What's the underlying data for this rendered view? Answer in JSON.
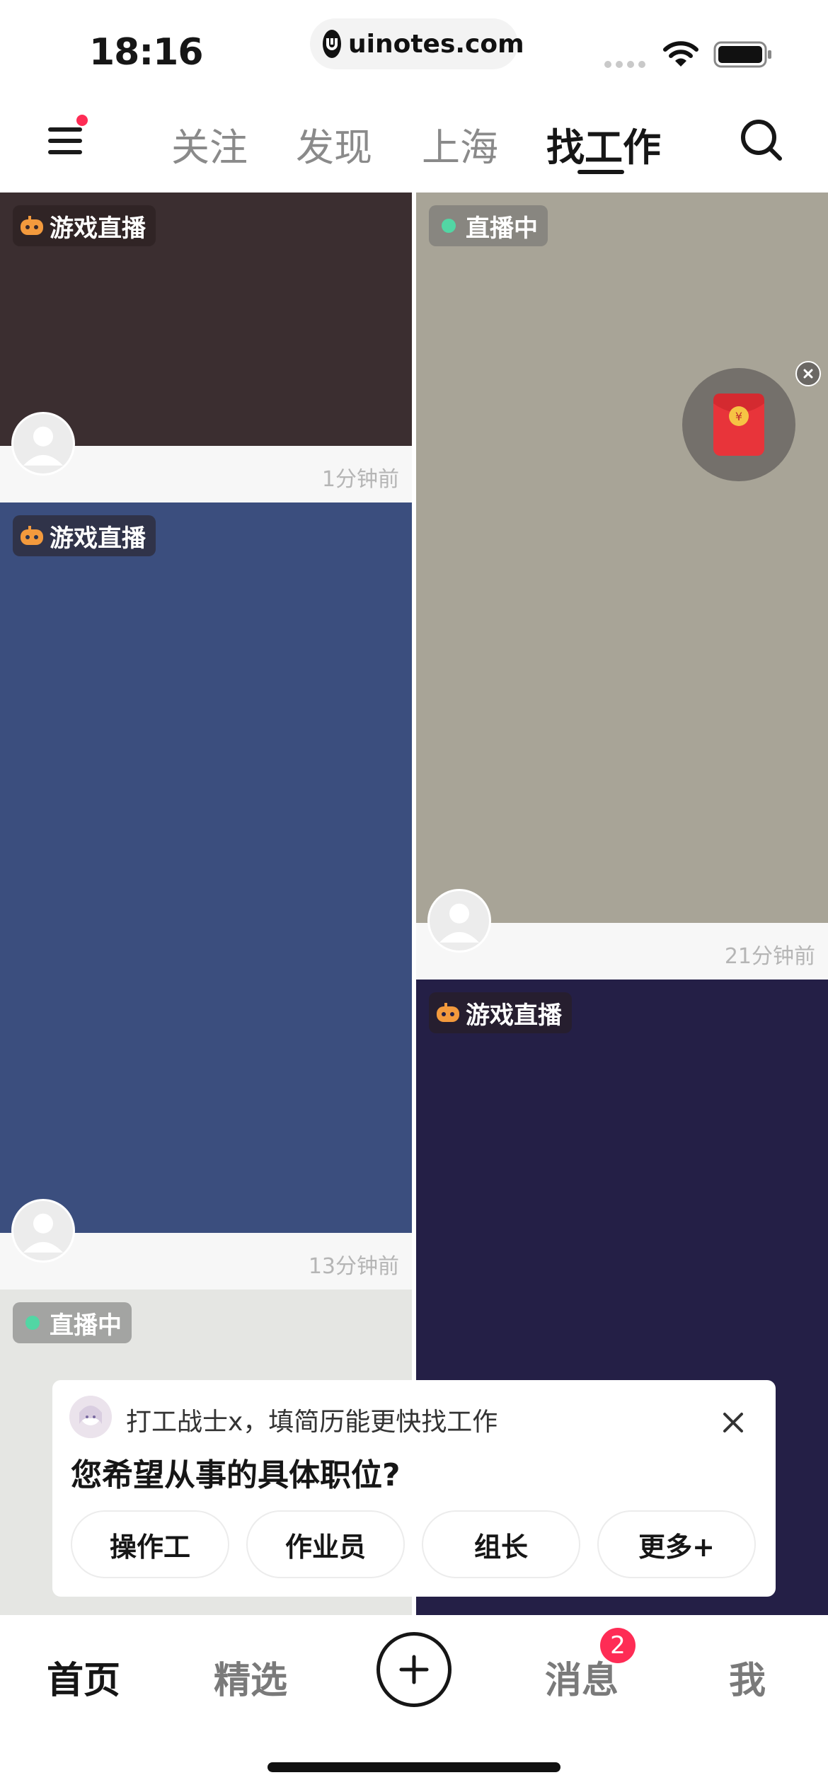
{
  "status_bar": {
    "time": "18:16",
    "url": "uinotes.com"
  },
  "top_nav": {
    "tabs": [
      {
        "label": "关注"
      },
      {
        "label": "发现"
      },
      {
        "label": "上海"
      },
      {
        "label": "找工作",
        "active": true
      }
    ],
    "menu_has_notification_dot": true
  },
  "feed": {
    "cards": [
      {
        "badge": "游戏直播",
        "badge_icon": "gamepad-icon",
        "time": "1分钟前",
        "cover_color": "#3b2e30"
      },
      {
        "badge": "直播中",
        "badge_icon": "live-dot-icon",
        "time": "21分钟前",
        "cover_color": "#a8a497"
      },
      {
        "badge": "游戏直播",
        "badge_icon": "gamepad-icon",
        "time": "13分钟前",
        "cover_color": "#3b4e7e"
      },
      {
        "badge": "游戏直播",
        "badge_icon": "gamepad-icon",
        "cover_color": "#241f46"
      },
      {
        "badge": "直播中",
        "badge_icon": "live-dot-icon",
        "cover_color": "#e5e6e3"
      }
    ]
  },
  "floating_widget": {
    "icon": "red-packet-icon",
    "glyph": "¥"
  },
  "job_prompt": {
    "subtitle": "打工战士x，填简历能更快找工作",
    "question": "您希望从事的具体职位?",
    "options": [
      "操作工",
      "作业员",
      "组长",
      "更多+"
    ]
  },
  "bottom_bar": {
    "tabs": [
      {
        "label": "首页",
        "active": true
      },
      {
        "label": "精选"
      },
      {
        "label": "消息"
      },
      {
        "label": "我"
      }
    ],
    "message_badge": "2"
  },
  "colors": {
    "accent": "#fe2c55",
    "live_green": "#52d6a4",
    "gamepad_orange": "#f39a3d"
  }
}
